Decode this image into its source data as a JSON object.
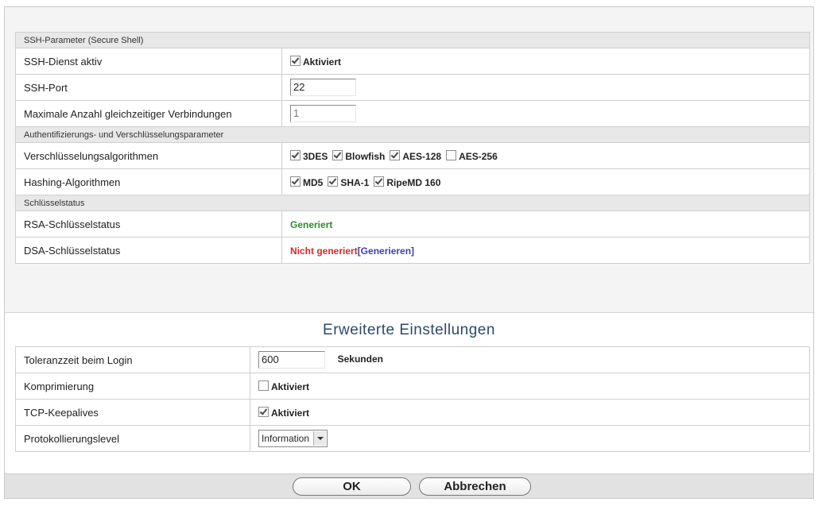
{
  "ssh_section": {
    "header": "SSH-Parameter (Secure Shell)",
    "service_label": "SSH-Dienst aktiv",
    "service_checkbox_label": "Aktiviert",
    "service_checked": true,
    "port_label": "SSH-Port",
    "port_value": "22",
    "max_conn_label": "Maximale Anzahl gleichzeitiger Verbindungen",
    "max_conn_value": "1"
  },
  "auth_section": {
    "header": "Authentifizierungs- und Verschlüsselungsparameter",
    "encryption_label": "Verschlüsselungsalgorithmen",
    "encryption_options": [
      {
        "label": "3DES",
        "checked": true
      },
      {
        "label": "Blowfish",
        "checked": true
      },
      {
        "label": "AES-128",
        "checked": true
      },
      {
        "label": "AES-256",
        "checked": false
      }
    ],
    "hashing_label": "Hashing-Algorithmen",
    "hashing_options": [
      {
        "label": "MD5",
        "checked": true
      },
      {
        "label": "SHA-1",
        "checked": true
      },
      {
        "label": "RipeMD 160",
        "checked": true
      }
    ]
  },
  "key_section": {
    "header": "Schlüsselstatus",
    "rsa_label": "RSA-Schlüsselstatus",
    "rsa_status": "Generiert",
    "dsa_label": "DSA-Schlüsselstatus",
    "dsa_status": "Nicht generiert",
    "dsa_action": "[Generieren]"
  },
  "advanced": {
    "title": "Erweiterte Einstellungen",
    "login_tolerance_label": "Toleranzzeit beim Login",
    "login_tolerance_value": "600",
    "login_tolerance_unit": "Sekunden",
    "compression_label": "Komprimierung",
    "compression_checkbox_label": "Aktiviert",
    "compression_checked": false,
    "keepalive_label": "TCP-Keepalives",
    "keepalive_checkbox_label": "Aktiviert",
    "keepalive_checked": true,
    "log_level_label": "Protokollierungslevel",
    "log_level_value": "Information"
  },
  "buttons": {
    "ok": "OK",
    "cancel": "Abbrechen"
  },
  "colors": {
    "status_ok": "#2f8a2f",
    "status_error": "#d42a2a",
    "link": "#3f3fae",
    "title": "#2c4a6b"
  }
}
